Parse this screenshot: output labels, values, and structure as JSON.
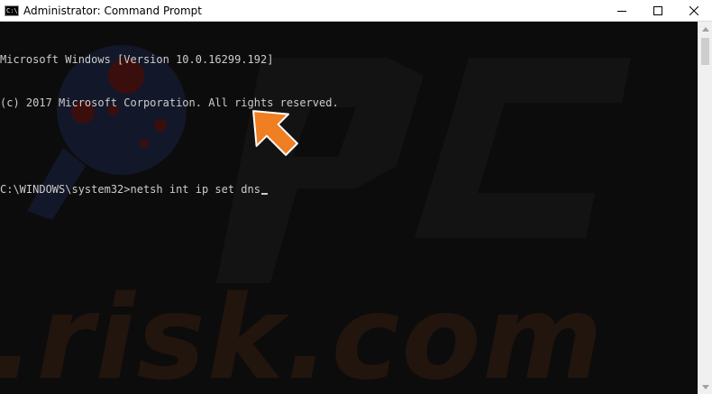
{
  "window": {
    "title": "Administrator: Command Prompt",
    "app_icon_text": "C:\\"
  },
  "console": {
    "lines": [
      "Microsoft Windows [Version 10.0.16299.192]",
      "(c) 2017 Microsoft Corporation. All rights reserved.",
      "",
      "C:\\WINDOWS\\system32>netsh int ip set dns"
    ]
  },
  "watermark": {
    "text": ".risk.com"
  },
  "colors": {
    "console_bg": "#0c0c0c",
    "console_text": "#cccccc",
    "arrow": "#f07e22"
  }
}
